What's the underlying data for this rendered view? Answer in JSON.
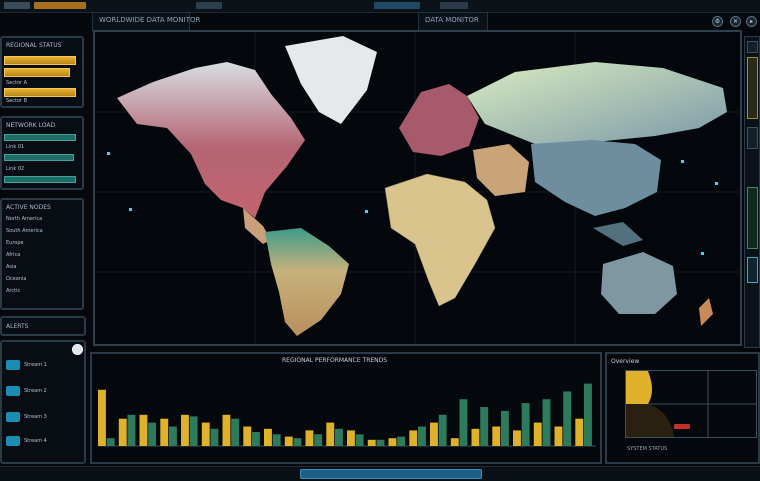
{
  "window": {
    "map_tab_title": "WORLDWIDE DATA MONITOR",
    "second_tab_title": "DATA MONITOR",
    "top_icons": [
      "settings-icon",
      "close-icon"
    ]
  },
  "left_panels": {
    "panel1": {
      "title": "REGIONAL STATUS",
      "rows": [
        "Sector A",
        "Sector B"
      ]
    },
    "panel2": {
      "title": "NETWORK LOAD",
      "rows": [
        "Link 01",
        "Link 02"
      ]
    },
    "panel3": {
      "title": "ACTIVE NODES",
      "rows": [
        "North America",
        "South America",
        "Europe",
        "Africa",
        "Asia",
        "Oceania",
        "Arctic"
      ]
    },
    "panel4": {
      "title": "ALERTS"
    },
    "panel5": {
      "items": [
        "Stream 1",
        "Stream 2",
        "Stream 3",
        "Stream 4"
      ]
    }
  },
  "chart_header": "REGIONAL PERFORMANCE TRENDS",
  "chart_data": {
    "type": "bar",
    "series": [
      {
        "name": "",
        "color": "#e0b12a",
        "values": [
          72,
          35,
          40,
          35,
          40,
          30,
          40,
          25,
          22,
          12,
          20,
          30,
          20,
          8,
          10,
          20,
          30,
          10,
          22,
          25,
          20,
          30,
          25,
          35
        ]
      },
      {
        "name": "",
        "color": "#2d7a5c",
        "values": [
          10,
          40,
          30,
          25,
          38,
          22,
          35,
          18,
          15,
          10,
          15,
          22,
          15,
          8,
          12,
          25,
          40,
          60,
          50,
          45,
          55,
          60,
          70,
          80
        ]
      }
    ]
  },
  "gauge_panel": {
    "title": "Overview",
    "footer": "SYSTEM STATUS"
  },
  "colors": {
    "accent": "#e7b32d",
    "teal": "#2d7a5c",
    "alert": "#c2322b"
  }
}
